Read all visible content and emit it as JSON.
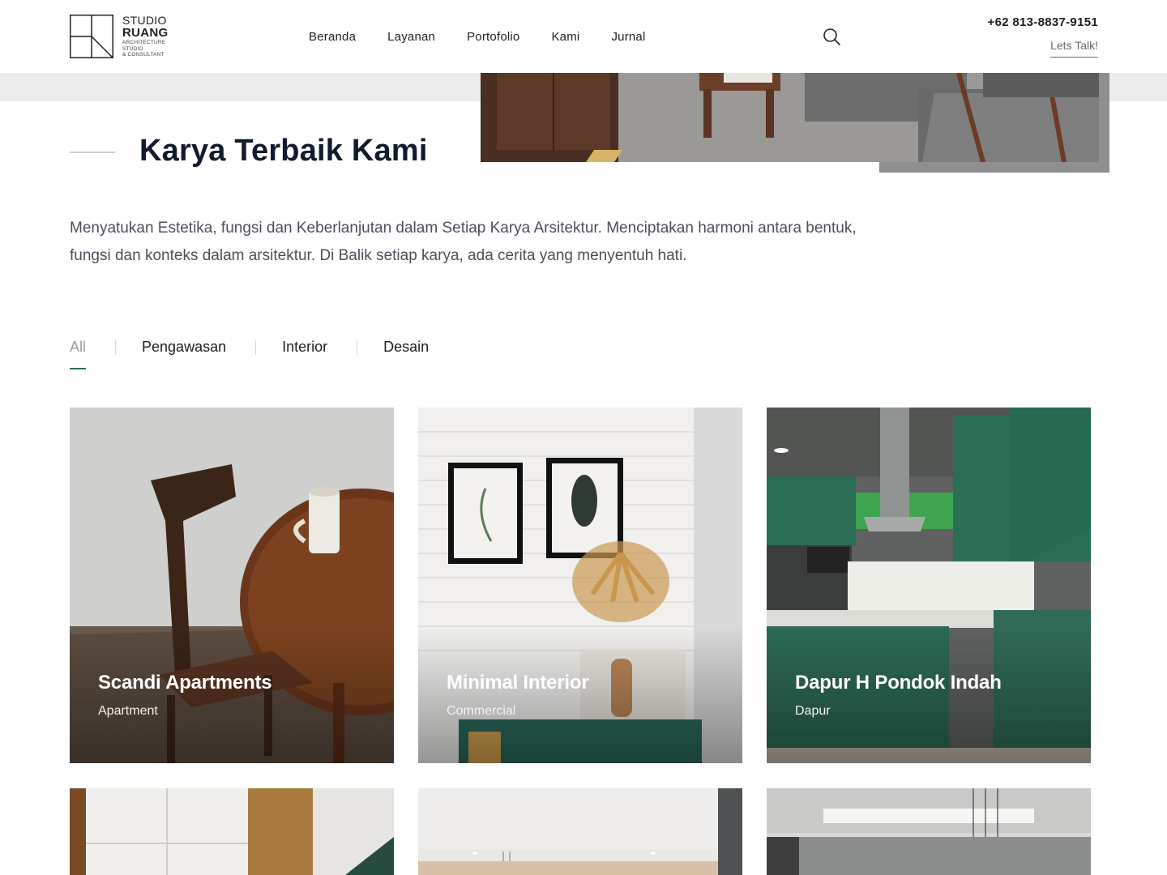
{
  "brand": {
    "line1": "STUDIO",
    "line2": "RUANG",
    "small1": "ARCHITECTURE",
    "small2": "STUDIO",
    "small3": "& CONSULTANT"
  },
  "nav": {
    "items": [
      {
        "label": "Beranda"
      },
      {
        "label": "Layanan"
      },
      {
        "label": "Portofolio"
      },
      {
        "label": "Kami"
      },
      {
        "label": "Jurnal"
      }
    ]
  },
  "header": {
    "search_icon": "search-icon",
    "phone": "+62 813-8837-9151",
    "cta_label": "Lets Talk!"
  },
  "section": {
    "title": "Karya Terbaik Kami",
    "description": "Menyatukan Estetika, fungsi dan Keberlanjutan dalam Setiap Karya Arsitektur. Menciptakan harmoni antara bentuk, fungsi dan konteks dalam arsitektur. Di Balik setiap karya, ada cerita yang menyentuh hati."
  },
  "filters": {
    "items": [
      {
        "label": "All",
        "active": true
      },
      {
        "label": "Pengawasan",
        "active": false
      },
      {
        "label": "Interior",
        "active": false
      },
      {
        "label": "Desain",
        "active": false
      }
    ]
  },
  "projects": [
    {
      "title": "Scandi Apartments",
      "category": "Apartment"
    },
    {
      "title": "Minimal Interior",
      "category": "Commercial"
    },
    {
      "title": "Dapur H Pondok Indah",
      "category": "Dapur"
    },
    {
      "title": "",
      "category": ""
    },
    {
      "title": "",
      "category": ""
    },
    {
      "title": "",
      "category": ""
    }
  ],
  "colors": {
    "accent": "#2f6b57",
    "heading": "#111a2e",
    "body_text": "#4d4f5c"
  }
}
